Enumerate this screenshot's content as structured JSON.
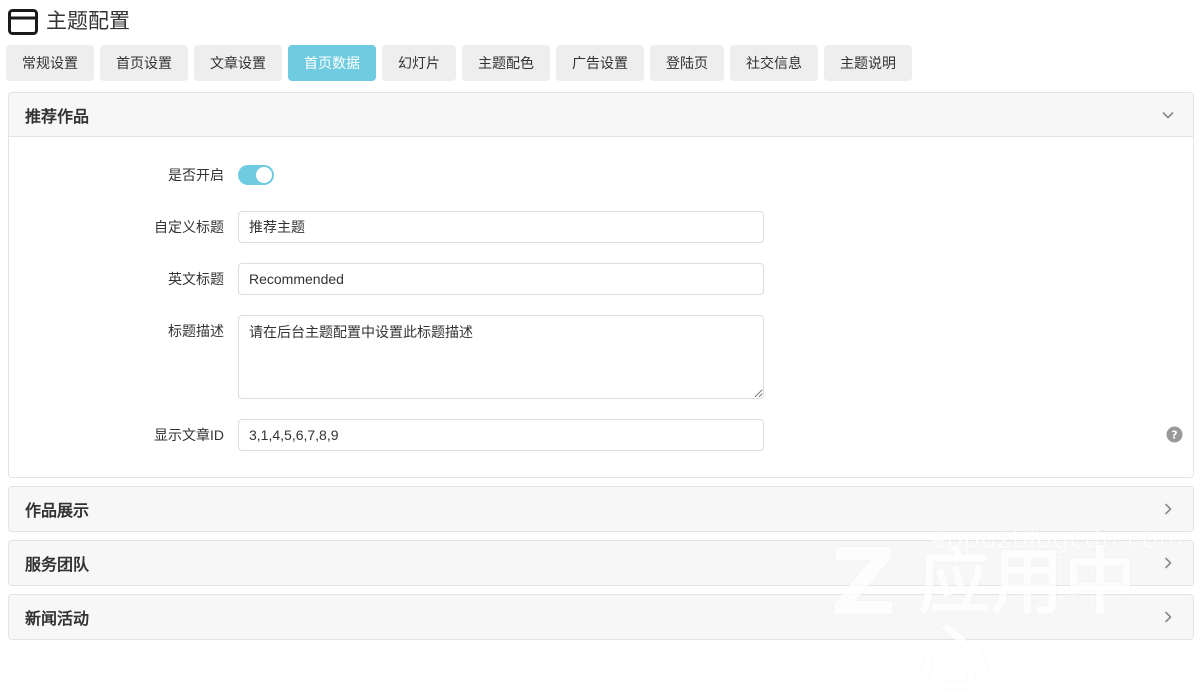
{
  "header": {
    "icon": "window-icon",
    "title": "主题配置"
  },
  "tabs": [
    {
      "label": "常规设置",
      "active": false
    },
    {
      "label": "首页设置",
      "active": false
    },
    {
      "label": "文章设置",
      "active": false
    },
    {
      "label": "首页数据",
      "active": true
    },
    {
      "label": "幻灯片",
      "active": false
    },
    {
      "label": "主题配色",
      "active": false
    },
    {
      "label": "广告设置",
      "active": false
    },
    {
      "label": "登陆页",
      "active": false
    },
    {
      "label": "社交信息",
      "active": false
    },
    {
      "label": "主题说明",
      "active": false
    }
  ],
  "panels": {
    "recommended": {
      "title": "推荐作品",
      "expanded": true,
      "chevron": "chevron-down-icon",
      "fields": {
        "enable": {
          "label": "是否开启",
          "value": "on"
        },
        "custom_title": {
          "label": "自定义标题",
          "value": "推荐主题",
          "placeholder": ""
        },
        "english_title": {
          "label": "英文标题",
          "value": "Recommended",
          "placeholder": ""
        },
        "title_description": {
          "label": "标题描述",
          "value": "请在后台主题配置中设置此标题描述",
          "placeholder": ""
        },
        "article_ids": {
          "label": "显示文章ID",
          "value": "3,1,4,5,6,7,8,9",
          "placeholder": "",
          "help_icon": "help-circle-icon"
        }
      }
    },
    "collapsed": [
      {
        "title": "作品展示",
        "chevron": "chevron-right-icon"
      },
      {
        "title": "服务团队",
        "chevron": "chevron-right-icon"
      },
      {
        "title": "新闻活动",
        "chevron": "chevron-right-icon"
      }
    ]
  },
  "watermark": {
    "domain": "appuzblogcdn.com",
    "logo_letter": "Z",
    "brand": "应用中心"
  },
  "colors": {
    "accent": "#6fcbe0",
    "tab_bg": "#eeeeee",
    "panel_head_bg": "#f7f7f7",
    "border": "#e3e3e3",
    "input_border": "#dddddd",
    "text": "#333333"
  }
}
